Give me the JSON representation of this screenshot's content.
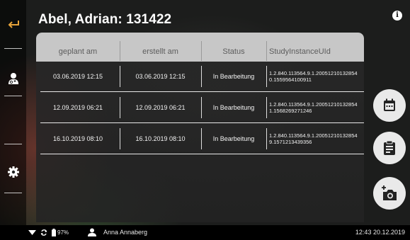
{
  "header": {
    "title": "Abel, Adrian: 131422"
  },
  "sidebar": {
    "items": [
      {
        "name": "back",
        "icon": "back-arrow-icon"
      },
      {
        "name": "doctor",
        "icon": "doctor-icon"
      },
      {
        "name": "settings",
        "icon": "gear-icon"
      }
    ],
    "back_color": "#e7a33a"
  },
  "table": {
    "columns": [
      "geplant am",
      "erstellt am",
      "Status",
      "StudyInstanceUId"
    ],
    "rows": [
      {
        "planned": "03.06.2019 12:15",
        "created": "03.06.2019 12:15",
        "status": "In Bearbeitung",
        "uid_line1": "1.2.840.113564.9.1.20051210132854",
        "uid_line2": "0.1559564100911"
      },
      {
        "planned": "12.09.2019 06:21",
        "created": "12.09.2019 06:21",
        "status": "In Bearbeitung",
        "uid_line1": "1.2.840.113564.9.1.20051210132854",
        "uid_line2": "1.1568269271246"
      },
      {
        "planned": "16.10.2019 08:10",
        "created": "16.10.2019 08:10",
        "status": "In Bearbeitung",
        "uid_line1": "1.2.840.113564.9.1.20051210132854",
        "uid_line2": "9.1571213439356"
      }
    ]
  },
  "actions": [
    {
      "name": "calendar",
      "icon": "calendar-icon"
    },
    {
      "name": "clipboard",
      "icon": "clipboard-icon"
    },
    {
      "name": "add-photo",
      "icon": "add-camera-icon"
    }
  ],
  "statusbar": {
    "battery": "97%",
    "user": "Anna Annaberg",
    "datetime": "12:43 20.12.2019"
  }
}
